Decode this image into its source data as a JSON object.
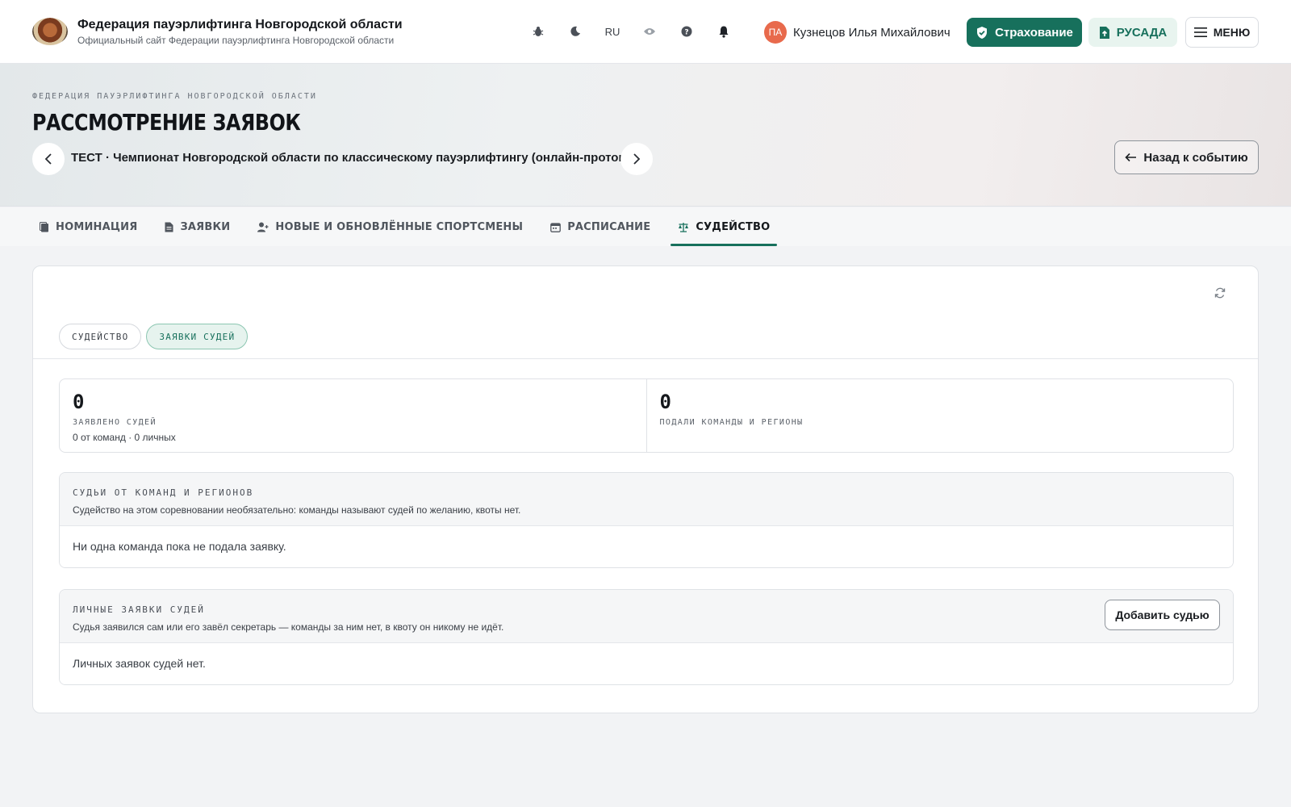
{
  "header": {
    "title": "Федерация пауэрлифтинга Новгородской области",
    "subtitle": "Официальный сайт Федерации пауэрлифтинга Новгородской области",
    "lang": "RU",
    "user_initials": "ПА",
    "user_name": "Кузнецов Илья Михайлович",
    "insurance_label": "Страхование",
    "rusada_label": "РУСАДА",
    "menu_label": "МЕНЮ"
  },
  "hero": {
    "kicker": "ФЕДЕРАЦИЯ ПАУЭРЛИФТИНГА НОВГОРОДСКОЙ ОБЛАСТИ",
    "title": "РАССМОТРЕНИЕ ЗАЯВОК",
    "event": "ТЕСТ · Чемпионат Новгородской области по классическому пауэрлифтингу (онлайн-протокол)",
    "back_label": "Назад к событию"
  },
  "tabs": [
    {
      "label": "НОМИНАЦИЯ"
    },
    {
      "label": "ЗАЯВКИ"
    },
    {
      "label": "НОВЫЕ И ОБНОВЛЁННЫЕ СПОРТСМЕНЫ"
    },
    {
      "label": "РАСПИСАНИЕ"
    },
    {
      "label": "СУДЕЙСТВО"
    }
  ],
  "active_tab": "СУДЕЙСТВО",
  "subtabs": [
    {
      "label": "СУДЕЙСТВО"
    },
    {
      "label": "ЗАЯВКИ СУДЕЙ"
    }
  ],
  "active_subtab": "ЗАЯВКИ СУДЕЙ",
  "stats": {
    "declared": {
      "value": "0",
      "label": "ЗАЯВЛЕНО СУДЕЙ",
      "note": "0 от команд · 0 личных"
    },
    "teams": {
      "value": "0",
      "label": "ПОДАЛИ КОМАНДЫ И РЕГИОНЫ"
    }
  },
  "teams_section": {
    "title": "СУДЬИ ОТ КОМАНД И РЕГИОНОВ",
    "desc": "Судейство на этом соревновании необязательно: команды называют судей по желанию, квоты нет.",
    "empty": "Ни одна команда пока не подала заявку."
  },
  "personal_section": {
    "title": "ЛИЧНЫЕ ЗАЯВКИ СУДЕЙ",
    "desc": "Судья заявился сам или его завёл секретарь — команды за ним нет, в квоту он никому не идёт.",
    "add_label": "Добавить судью",
    "empty": "Личных заявок судей нет."
  },
  "colors": {
    "accent": "#17705c",
    "accent_light": "#e6f3ee",
    "avatar": "#e86a4c"
  }
}
